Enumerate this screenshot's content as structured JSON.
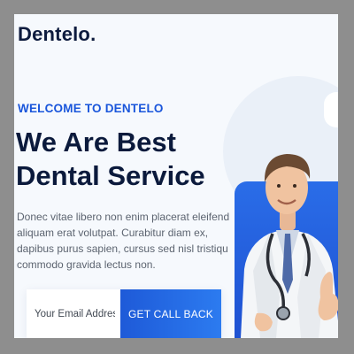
{
  "brand": {
    "logo": "Dentelo."
  },
  "hero": {
    "eyebrow": "WELCOME TO DENTELO",
    "headline_line1": "We Are Best",
    "headline_line2": "Dental Service",
    "body": "Donec vitae libero non enim placerat eleifend aliquam erat volutpat. Curabitur diam ex, dapibus purus sapien, cursus sed nisl tristiqu commodo gravida lectus non."
  },
  "cta": {
    "email_placeholder": "Your Email Address",
    "button_label": "GET CALL BACK"
  },
  "colors": {
    "accent": "#1a56db",
    "heading": "#0b1a3c",
    "panel": "#2a6de8",
    "frame_bg": "#f6f9fd",
    "outer_bg": "#8e8e8e"
  },
  "icons": {
    "doctor_image": "doctor-with-stethoscope-illustration"
  }
}
